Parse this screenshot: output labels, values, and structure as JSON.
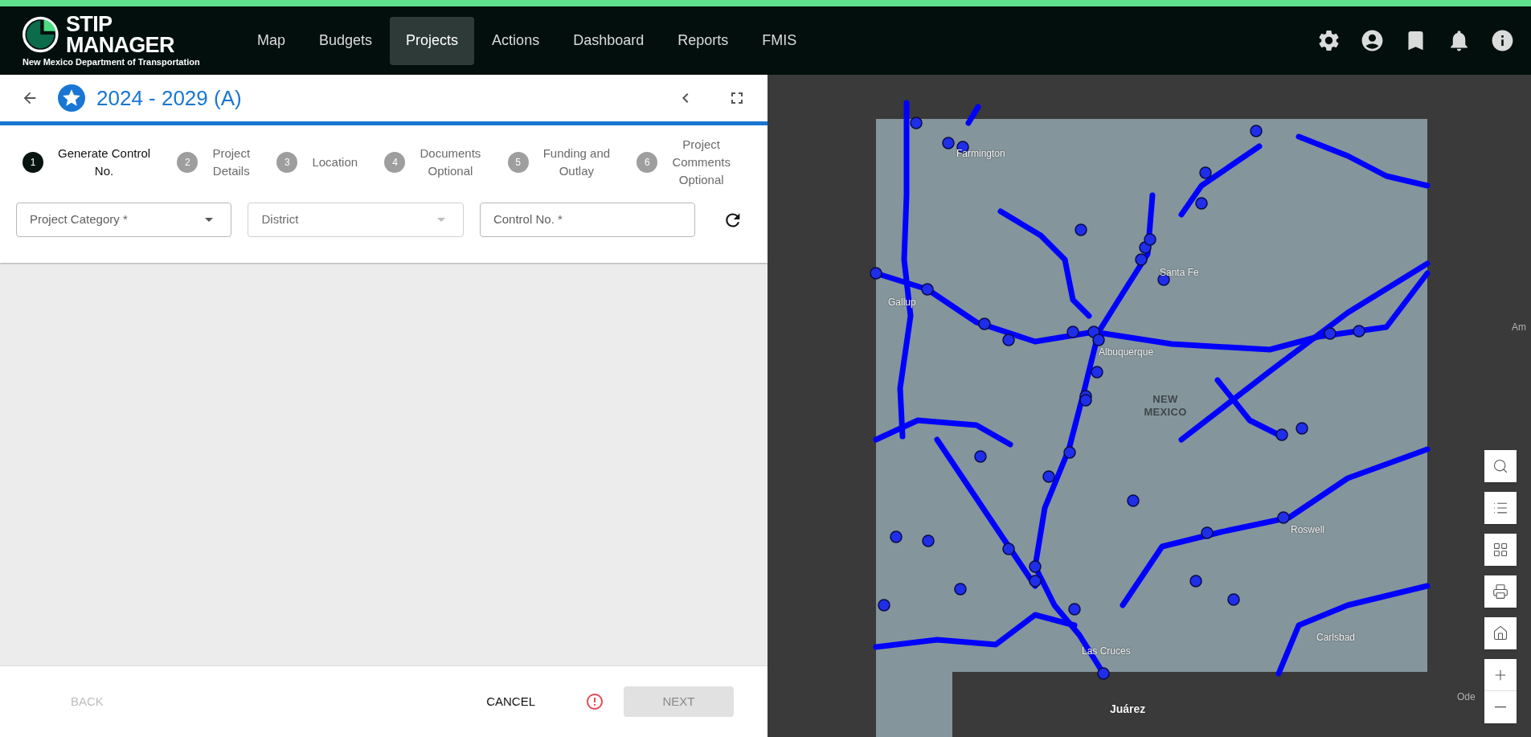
{
  "app": {
    "logo_line1": "STIP",
    "logo_line2": "MANAGER",
    "logo_subtitle": "New Mexico Department of Transportation"
  },
  "nav": [
    {
      "label": "Map",
      "selected": false
    },
    {
      "label": "Budgets",
      "selected": false
    },
    {
      "label": "Projects",
      "selected": true
    },
    {
      "label": "Actions",
      "selected": false
    },
    {
      "label": "Dashboard",
      "selected": false
    },
    {
      "label": "Reports",
      "selected": false
    },
    {
      "label": "FMIS",
      "selected": false
    }
  ],
  "panel": {
    "title": "2024 - 2029 (A)"
  },
  "steps": [
    {
      "number": "1",
      "lines": [
        "Generate Control",
        "No."
      ],
      "selected": true
    },
    {
      "number": "2",
      "lines": [
        "Project",
        "Details"
      ],
      "selected": false
    },
    {
      "number": "3",
      "lines": [
        "Location"
      ],
      "selected": false
    },
    {
      "number": "4",
      "lines": [
        "Documents",
        "Optional"
      ],
      "selected": false
    },
    {
      "number": "5",
      "lines": [
        "Funding and",
        "Outlay"
      ],
      "selected": false
    },
    {
      "number": "6",
      "lines": [
        "Project",
        "Comments",
        "Optional"
      ],
      "selected": false
    }
  ],
  "fields": [
    {
      "placeholder": "Project Category *",
      "kind": "select",
      "disabled": false
    },
    {
      "placeholder": "District",
      "kind": "select",
      "disabled": true
    },
    {
      "placeholder": "Control No. *",
      "kind": "text",
      "disabled": false
    }
  ],
  "footer": {
    "back": {
      "label": "BACK",
      "disabled": true
    },
    "cancel": {
      "label": "CANCEL"
    },
    "error": true,
    "next": {
      "label": "NEXT",
      "disabled": true
    }
  },
  "map_labels": [
    {
      "text": "Farmington",
      "kind": "city"
    },
    {
      "text": "Gallup",
      "kind": "city"
    },
    {
      "text": "Santa Fe",
      "kind": "city"
    },
    {
      "text": "Albuquerque",
      "kind": "city"
    },
    {
      "text": "NEW MEXICO",
      "kind": "state"
    },
    {
      "text": "Roswell",
      "kind": "city"
    },
    {
      "text": "Las Cruces",
      "kind": "city"
    },
    {
      "text": "Carlsbad",
      "kind": "city"
    },
    {
      "text": "Juárez",
      "kind": "major"
    },
    {
      "text": "Am",
      "kind": "faint"
    },
    {
      "text": "Ode",
      "kind": "faint"
    }
  ]
}
